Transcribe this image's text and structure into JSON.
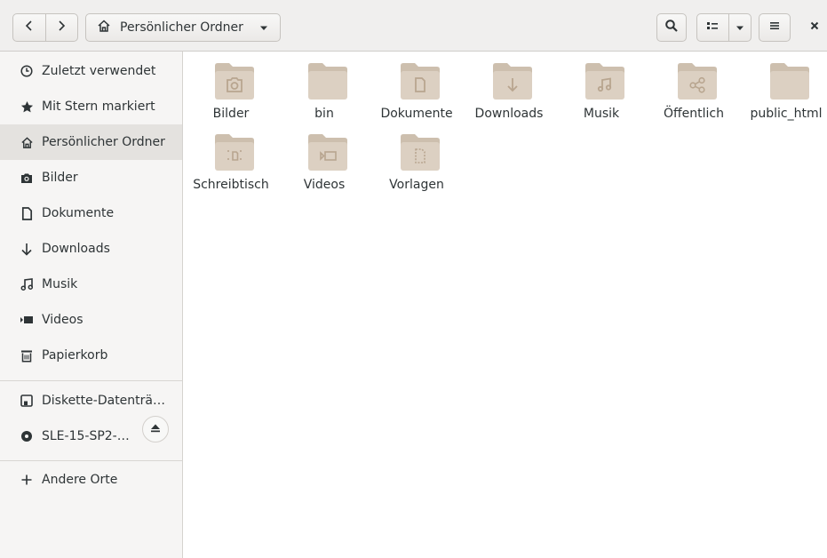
{
  "header": {
    "path_label": "Persönlicher Ordner",
    "back_icon": "chevron-left-icon",
    "forward_icon": "chevron-right-icon",
    "home_icon": "home-icon",
    "search_icon": "search-icon",
    "view_icon": "list-view-icon",
    "menu_icon": "hamburger-icon",
    "close_icon": "close-icon"
  },
  "sidebar": {
    "items": [
      {
        "label": "Zuletzt verwendet",
        "icon": "clock-icon"
      },
      {
        "label": "Mit Stern markiert",
        "icon": "star-icon"
      },
      {
        "label": "Persönlicher Ordner",
        "icon": "home-icon",
        "selected": true
      },
      {
        "label": "Bilder",
        "icon": "camera-icon"
      },
      {
        "label": "Dokumente",
        "icon": "document-icon"
      },
      {
        "label": "Downloads",
        "icon": "download-arrow-icon"
      },
      {
        "label": "Musik",
        "icon": "music-note-icon"
      },
      {
        "label": "Videos",
        "icon": "video-icon"
      },
      {
        "label": "Papierkorb",
        "icon": "trash-icon"
      },
      {
        "label": "Diskette-Datenträ…",
        "icon": "floppy-icon"
      },
      {
        "label": "SLE-15-SP2-…",
        "icon": "disc-icon",
        "eject_icon": "eject-icon"
      },
      {
        "label": "Andere Orte",
        "icon": "plus-icon"
      }
    ]
  },
  "files": [
    {
      "name": "Bilder",
      "emblem": "camera-icon"
    },
    {
      "name": "bin",
      "emblem": ""
    },
    {
      "name": "Dokumente",
      "emblem": "document-icon"
    },
    {
      "name": "Downloads",
      "emblem": "download-arrow-icon"
    },
    {
      "name": "Musik",
      "emblem": "music-note-icon"
    },
    {
      "name": "Öffentlich",
      "emblem": "share-icon"
    },
    {
      "name": "public_html",
      "emblem": ""
    },
    {
      "name": "Schreibtisch",
      "emblem": "desktop-icon"
    },
    {
      "name": "Videos",
      "emblem": "video-icon"
    },
    {
      "name": "Vorlagen",
      "emblem": "template-icon"
    }
  ],
  "colors": {
    "folder_body": "#dcd0c2",
    "folder_tab": "#cdbfae",
    "folder_emblem": "#b8a58f",
    "sidebar_selected": "#e4e2df"
  }
}
